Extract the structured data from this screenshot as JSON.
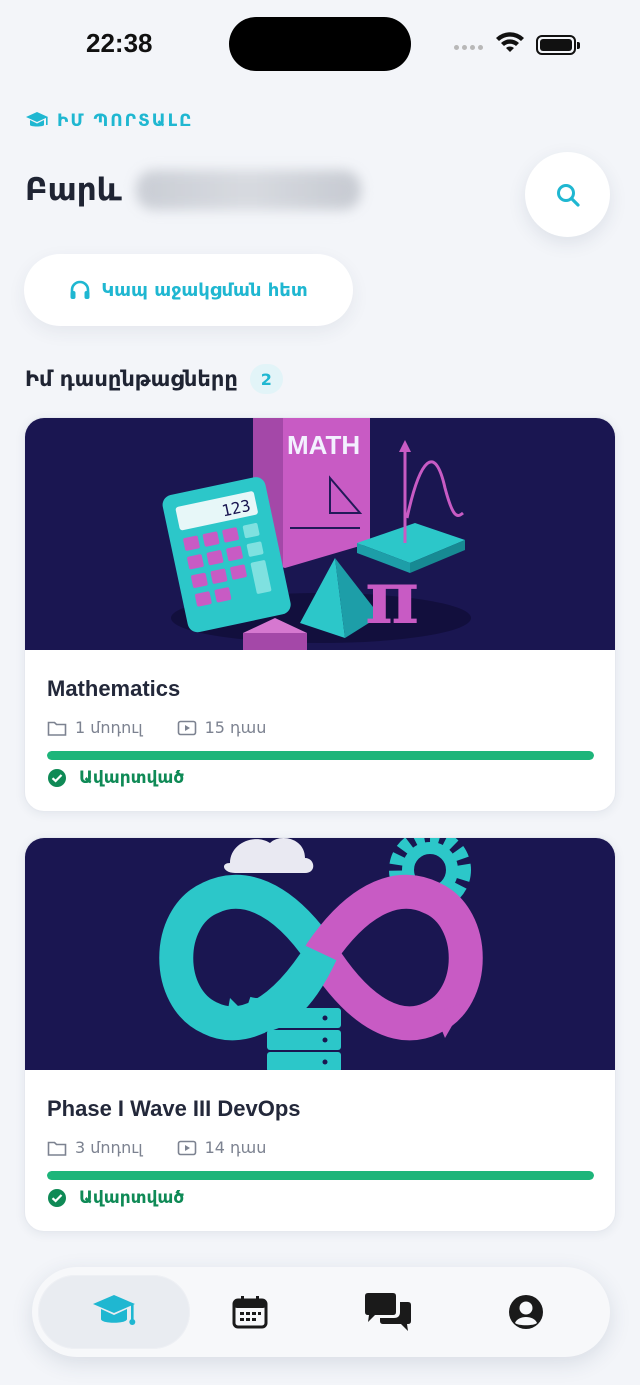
{
  "status_bar": {
    "time": "22:38"
  },
  "header": {
    "portal_label": "ԻՄ ՊՈՐՏԱԼԸ",
    "greeting": "Բարև"
  },
  "support": {
    "label": "Կապ աջակցման հետ"
  },
  "courses_section": {
    "title": "Իմ դասընթացները",
    "count": "2"
  },
  "courses": [
    {
      "title": "Mathematics",
      "modules": "1 մոդուլ",
      "lessons": "15 դաս",
      "progress": 1.0,
      "status": "Ավարտված",
      "cover_text": "MATH",
      "calculator_display": "123"
    },
    {
      "title": "Phase I Wave III DevOps",
      "modules": "3 մոդուլ",
      "lessons": "14 դաս",
      "progress": 1.0,
      "status": "Ավարտված"
    }
  ],
  "colors": {
    "accent": "#1fb7d1",
    "success": "#1db57a",
    "cover_bg": "#1a1651",
    "teal": "#2cc7c9",
    "magenta": "#c85bc4"
  },
  "icons": [
    "graduation-cap-icon",
    "search-icon",
    "headphones-icon",
    "folder-icon",
    "play-icon",
    "check-circle-icon",
    "calendar-icon",
    "chat-icon",
    "user-icon"
  ]
}
